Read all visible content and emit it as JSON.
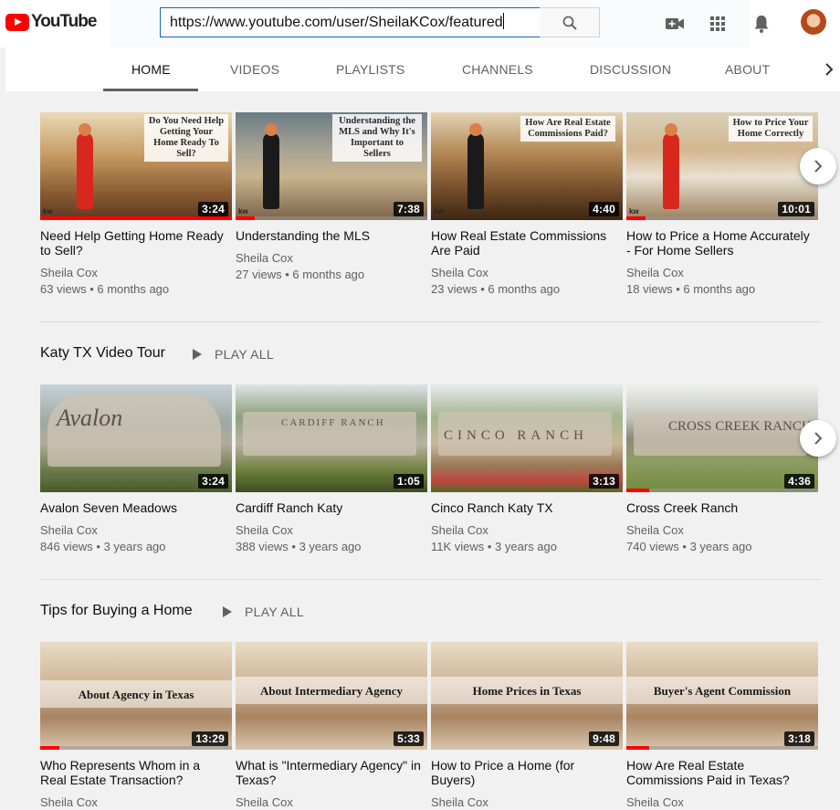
{
  "browser": {
    "url": "https://www.youtube.com/user/SheilaKCox/featured"
  },
  "header": {
    "logo_text": "YouTube",
    "icons": [
      "create-video-icon",
      "apps-grid-icon",
      "notifications-bell-icon",
      "avatar"
    ]
  },
  "tabs": [
    {
      "label": "HOME",
      "active": true
    },
    {
      "label": "VIDEOS"
    },
    {
      "label": "PLAYLISTS"
    },
    {
      "label": "CHANNELS"
    },
    {
      "label": "DISCUSSION"
    },
    {
      "label": "ABOUT"
    }
  ],
  "shelves": [
    {
      "title": "",
      "play_all": "",
      "videos": [
        {
          "title": "Need Help Getting Home Ready to Sell?",
          "channel": "Sheila Cox",
          "meta": "63 views • 6 months ago",
          "duration": "3:24",
          "watched": 1.0,
          "thumb_text": "Do You Need Help Getting Your Home Ready To Sell?"
        },
        {
          "title": "Understanding the MLS",
          "channel": "Sheila Cox",
          "meta": "27 views • 6 months ago",
          "duration": "7:38",
          "watched": 0.1,
          "thumb_text": "Understanding the MLS and Why It's Important to Sellers"
        },
        {
          "title": "How Real Estate Commissions Are Paid",
          "channel": "Sheila Cox",
          "meta": "23 views • 6 months ago",
          "duration": "4:40",
          "watched": 0.0,
          "thumb_text": "How Are Real Estate Commissions Paid?"
        },
        {
          "title": "How to Price a Home Accurately - For Home Sellers",
          "channel": "Sheila Cox",
          "meta": "18 views • 6 months ago",
          "duration": "10:01",
          "watched": 0.1,
          "thumb_text": "How to Price Your Home Correctly"
        }
      ]
    },
    {
      "title": "Katy TX Video Tour",
      "play_all": "PLAY ALL",
      "videos": [
        {
          "title": "Avalon Seven Meadows",
          "channel": "Sheila Cox",
          "meta": "846 views • 3 years ago",
          "duration": "3:24",
          "watched": 0.0,
          "thumb_text": "Avalon"
        },
        {
          "title": "Cardiff Ranch Katy",
          "channel": "Sheila Cox",
          "meta": "388 views • 3 years ago",
          "duration": "1:05",
          "watched": 0.0,
          "thumb_text": "CARDIFF RANCH"
        },
        {
          "title": "Cinco Ranch Katy TX",
          "channel": "Sheila Cox",
          "meta": "11K views • 3 years ago",
          "duration": "3:13",
          "watched": 0.0,
          "thumb_text": "CINCO RANCH"
        },
        {
          "title": "Cross Creek Ranch",
          "channel": "Sheila Cox",
          "meta": "740 views • 3 years ago",
          "duration": "4:36",
          "watched": 0.12,
          "thumb_text": "CROSS CREEK RANCH"
        }
      ]
    },
    {
      "title": "Tips for Buying a Home",
      "play_all": "PLAY ALL",
      "videos": [
        {
          "title": "Who Represents Whom in a Real Estate Transaction?",
          "channel": "Sheila Cox",
          "meta": "",
          "duration": "13:29",
          "watched": 0.1,
          "thumb_text": "About Agency in Texas"
        },
        {
          "title": "What is \"Intermediary Agency\" in Texas?",
          "channel": "Sheila Cox",
          "meta": "",
          "duration": "5:33",
          "watched": 0.0,
          "thumb_text": "About Intermediary Agency"
        },
        {
          "title": "How to Price a Home (for Buyers)",
          "channel": "Sheila Cox",
          "meta": "",
          "duration": "9:48",
          "watched": 0.0,
          "thumb_text": "Home Prices in Texas"
        },
        {
          "title": "How Are Real Estate Commissions Paid in Texas?",
          "channel": "Sheila Cox",
          "meta": "",
          "duration": "3:18",
          "watched": 0.12,
          "thumb_text": "Buyer's Agent Commission"
        }
      ]
    }
  ],
  "colors": {
    "brand_red": "#ff0000",
    "page_bg": "#f1f1f1",
    "text_secondary": "#606060",
    "url_border": "#1c62b9"
  }
}
